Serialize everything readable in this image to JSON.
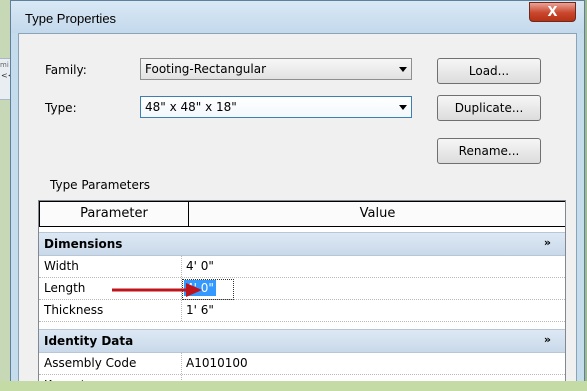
{
  "background_app": {
    "fragment_text": "<<",
    "fragment_text_top": "mi"
  },
  "dialog": {
    "title": "Type Properties",
    "close_label": "X",
    "family_label": "Family:",
    "family_value": "Footing-Rectangular",
    "type_label": "Type:",
    "type_value": "48\" x 48\" x 18\"",
    "buttons": {
      "load": "Load...",
      "duplicate": "Duplicate...",
      "rename": "Rename..."
    },
    "type_parameters_label": "Type Parameters",
    "grid": {
      "columns": [
        "Parameter",
        "Value"
      ],
      "groups": [
        {
          "name": "Dimensions",
          "collapse_glyph": "»",
          "rows": [
            {
              "name": "Width",
              "value": "4'  0\""
            },
            {
              "name": "Length",
              "value": "4'  0\""
            },
            {
              "name": "Thickness",
              "value": "1'  6\""
            }
          ]
        },
        {
          "name": "Identity Data",
          "collapse_glyph": "»",
          "rows": [
            {
              "name": "Assembly Code",
              "value": "A1010100"
            },
            {
              "name": "Keynote",
              "value": ""
            }
          ]
        }
      ]
    }
  },
  "annotation": {
    "arrow_color": "#c0141c"
  },
  "colors": {
    "selection": "#3399ff",
    "group_header": "#d3e1ef",
    "close_button": "#c9462c"
  }
}
